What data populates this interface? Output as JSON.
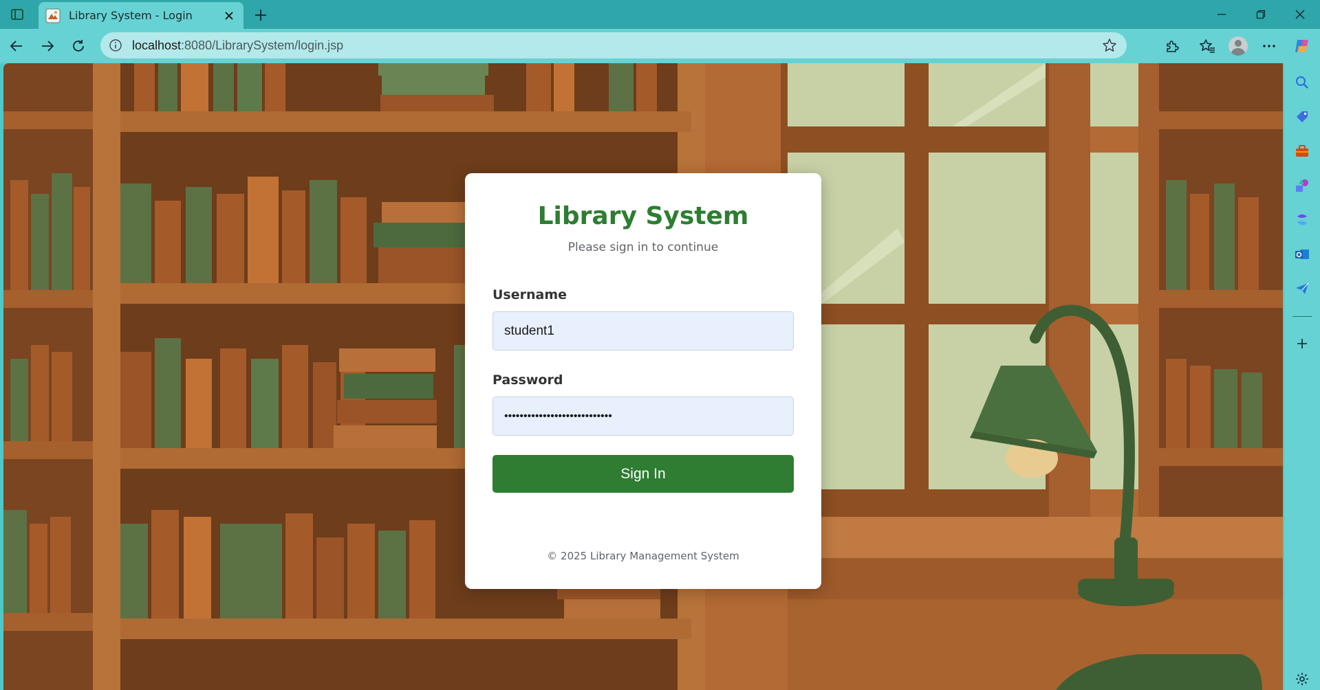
{
  "browser": {
    "tab": {
      "title": "Library System - Login"
    },
    "address_bar": {
      "url_host": "localhost",
      "url_rest": ":8080/LibrarySystem/login.jsp"
    }
  },
  "login": {
    "heading": "Library System",
    "subtitle": "Please sign in to continue",
    "username_label": "Username",
    "username_value": "student1",
    "password_label": "Password",
    "password_value": "••••••••••••••••••••••••••••",
    "submit_label": "Sign In",
    "footer": "© 2025 Library Management System"
  },
  "colors": {
    "brand_green": "#2e7d32",
    "chrome_teal": "#66d2d3",
    "input_fill": "#e8f0fe"
  }
}
